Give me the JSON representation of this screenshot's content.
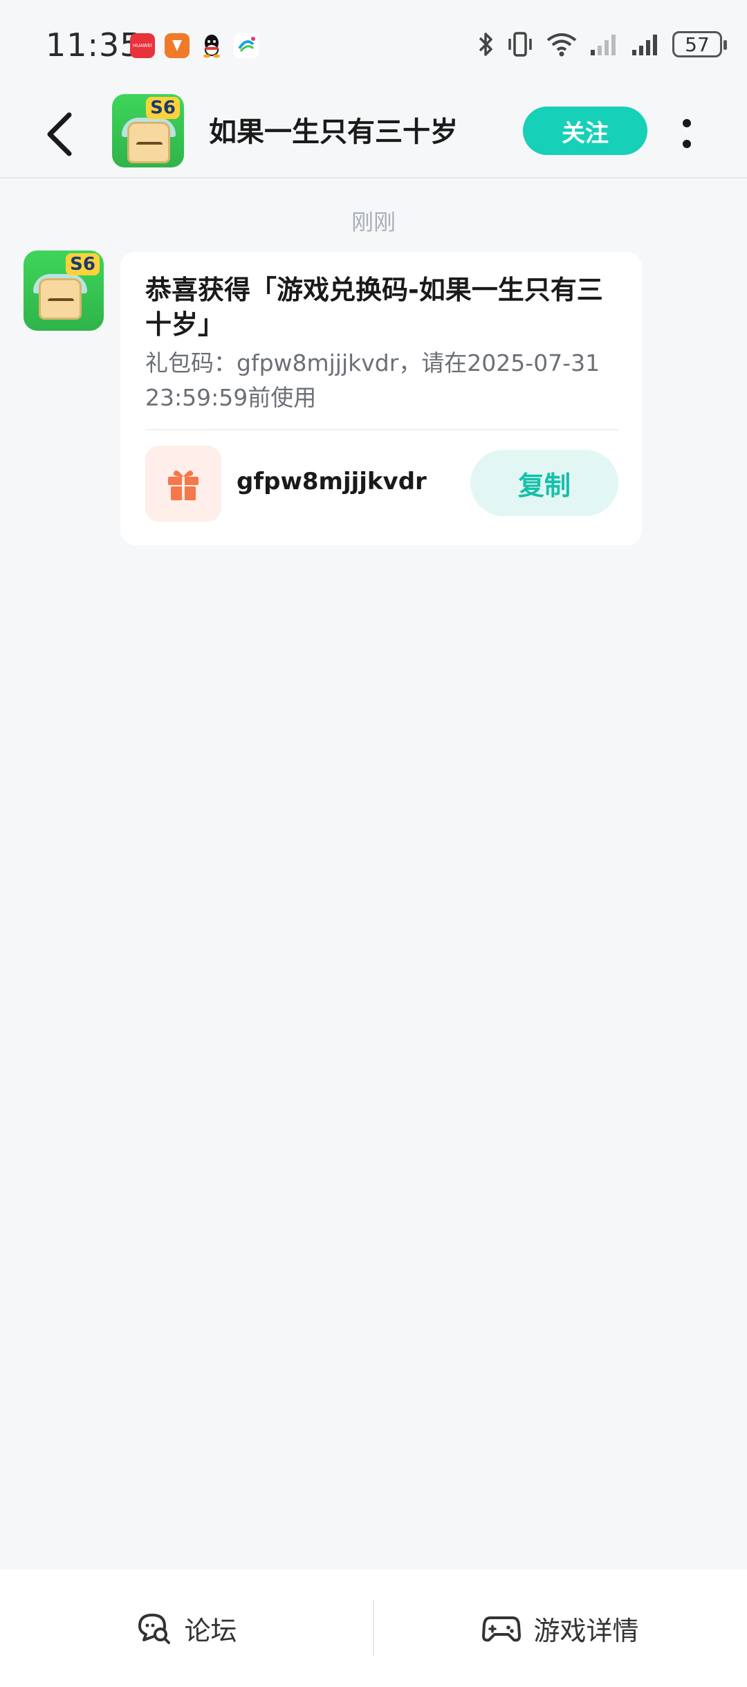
{
  "status_bar": {
    "time": "11:35",
    "battery": "57",
    "app_icons": [
      "huawei-appgallery-icon",
      "kuaishou-icon",
      "qq-icon",
      "china-mobile-icon"
    ],
    "huawei_label": "HUAWEI"
  },
  "header": {
    "title": "如果一生只有三十岁",
    "follow_label": "关注",
    "game_badge": "S6"
  },
  "chat": {
    "timestamp": "刚刚",
    "message": {
      "title": "恭喜获得「游戏兑换码-如果一生只有三十岁」",
      "description": "礼包码：gfpw8mjjjkvdr，请在2025-07-31 23:59:59前使用",
      "code": "gfpw8mjjjkvdr",
      "copy_label": "复制"
    }
  },
  "bottom_nav": {
    "forum_label": "论坛",
    "detail_label": "游戏详情"
  },
  "colors": {
    "accent": "#16d0b7",
    "copy_bg": "#e2f7f4",
    "gift": "#f5784a",
    "background": "#f5f7f9"
  }
}
